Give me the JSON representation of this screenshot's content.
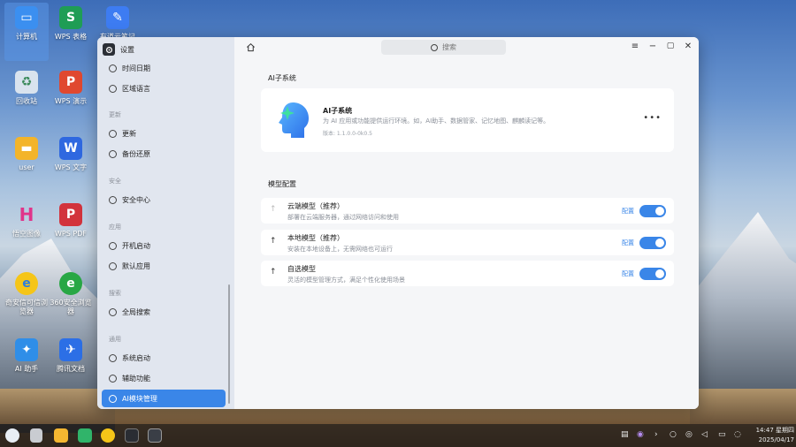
{
  "desktop": {
    "icons": [
      {
        "label": "计算机",
        "icon": "computer-icon",
        "color": "#3b8ff0"
      },
      {
        "label": "WPS 表格",
        "icon": "wps-sheet-icon",
        "color": "#1f9d55"
      },
      {
        "label": "有道云笔记",
        "icon": "note-icon",
        "color": "#3d7cf2"
      },
      {
        "label": "回收站",
        "icon": "trash-icon",
        "color": "#d9e3ee"
      },
      {
        "label": "WPS 演示",
        "icon": "wps-slides-icon",
        "color": "#e0482f"
      },
      {
        "label": "user",
        "icon": "folder-icon",
        "color": "#f3b42a"
      },
      {
        "label": "WPS 文字",
        "icon": "wps-writer-icon",
        "color": "#2f68e0"
      },
      {
        "label": "悟空图像",
        "icon": "image-app-icon",
        "color": "#e0348a"
      },
      {
        "label": "WPS PDF",
        "icon": "wps-pdf-icon",
        "color": "#d2333c"
      },
      {
        "label": "奇安信可信浏览器",
        "icon": "browser-icon",
        "color": "#2b7de0"
      },
      {
        "label": "360安全浏览器",
        "icon": "browser-360-icon",
        "color": "#28a745"
      },
      {
        "label": "AI 助手",
        "icon": "ai-assistant-icon",
        "color": "#2f8ee8"
      },
      {
        "label": "腾讯文档",
        "icon": "tencent-docs-icon",
        "color": "#2c6fe6"
      }
    ]
  },
  "settings": {
    "title": "设置",
    "search_placeholder": "搜索",
    "sidebar": {
      "items": [
        {
          "label": "时间日期"
        },
        {
          "label": "区域语言"
        },
        {
          "label": "更新"
        },
        {
          "label": "备份还原"
        },
        {
          "label": "安全中心"
        },
        {
          "label": "开机启动"
        },
        {
          "label": "默认应用"
        },
        {
          "label": "全局搜索"
        },
        {
          "label": "系统启动"
        },
        {
          "label": "辅助功能"
        },
        {
          "label": "AI模块管理"
        }
      ],
      "headers": [
        "更新",
        "安全",
        "应用",
        "搜索",
        "通用"
      ]
    },
    "ai_section": {
      "title": "AI子系统",
      "name": "AI子系统",
      "desc": "为 AI 应用或功能提供运行环境。如，AI助手、数据管家、记忆地图、麒麟读记等。",
      "version": "版本: 1.1.0.0-0k0.5"
    },
    "model_section": {
      "title": "模型配置",
      "config_label": "配置",
      "rows": [
        {
          "title": "云端模型（推荐）",
          "desc": "部署在云端服务器，通过网络访问和使用"
        },
        {
          "title": "本地模型（推荐）",
          "desc": "安装在本地设备上，无需网络也可运行"
        },
        {
          "title": "自选模型",
          "desc": "灵活的模型管理方式，满足个性化使用场景"
        }
      ]
    }
  },
  "taskbar": {
    "time": "14:47 星期四",
    "date": "2025/04/17"
  }
}
